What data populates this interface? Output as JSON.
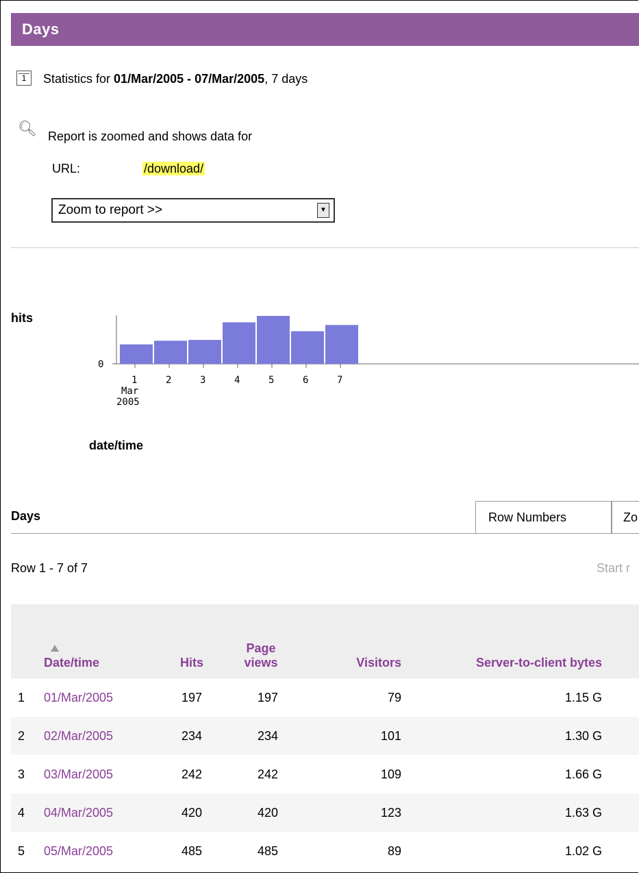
{
  "header": {
    "title": "Days"
  },
  "stats": {
    "prefix": "Statistics for",
    "range": "01/Mar/2005 - 07/Mar/2005",
    "suffix": ", 7 days"
  },
  "zoom": {
    "note": "Report is zoomed and shows data for",
    "url_label": "URL:",
    "url_value": "/download/",
    "select_value": "Zoom to report >>"
  },
  "chart_data": {
    "type": "bar",
    "ylabel": "hits",
    "xlabel": "date/time",
    "categories": [
      "1",
      "2",
      "3",
      "4",
      "5",
      "6",
      "7"
    ],
    "x_sublabels": [
      "Mar",
      "2005"
    ],
    "y_tick": "0",
    "values": [
      197,
      234,
      242,
      420,
      485,
      330,
      393
    ]
  },
  "tabs": {
    "section_title": "Days",
    "items": [
      "Row Numbers",
      "Zo"
    ]
  },
  "pagination": {
    "rows_text": "Row 1 - 7 of 7",
    "start_text": "Start r"
  },
  "table": {
    "columns": [
      "Date/time",
      "Hits",
      "Page views",
      "Visitors",
      "Server-to-client bytes"
    ],
    "rows": [
      {
        "n": "1",
        "date": "01/Mar/2005",
        "hits": "197",
        "views": "197",
        "visitors": "79",
        "bytes": "1.15 G"
      },
      {
        "n": "2",
        "date": "02/Mar/2005",
        "hits": "234",
        "views": "234",
        "visitors": "101",
        "bytes": "1.30 G"
      },
      {
        "n": "3",
        "date": "03/Mar/2005",
        "hits": "242",
        "views": "242",
        "visitors": "109",
        "bytes": "1.66 G"
      },
      {
        "n": "4",
        "date": "04/Mar/2005",
        "hits": "420",
        "views": "420",
        "visitors": "123",
        "bytes": "1.63 G"
      },
      {
        "n": "5",
        "date": "05/Mar/2005",
        "hits": "485",
        "views": "485",
        "visitors": "89",
        "bytes": "1.02 G"
      }
    ]
  },
  "colors": {
    "header_bg": "#8f5b9b",
    "accent": "#8a3f97",
    "bar": "#7b7bdc",
    "highlight": "#ffff66"
  }
}
